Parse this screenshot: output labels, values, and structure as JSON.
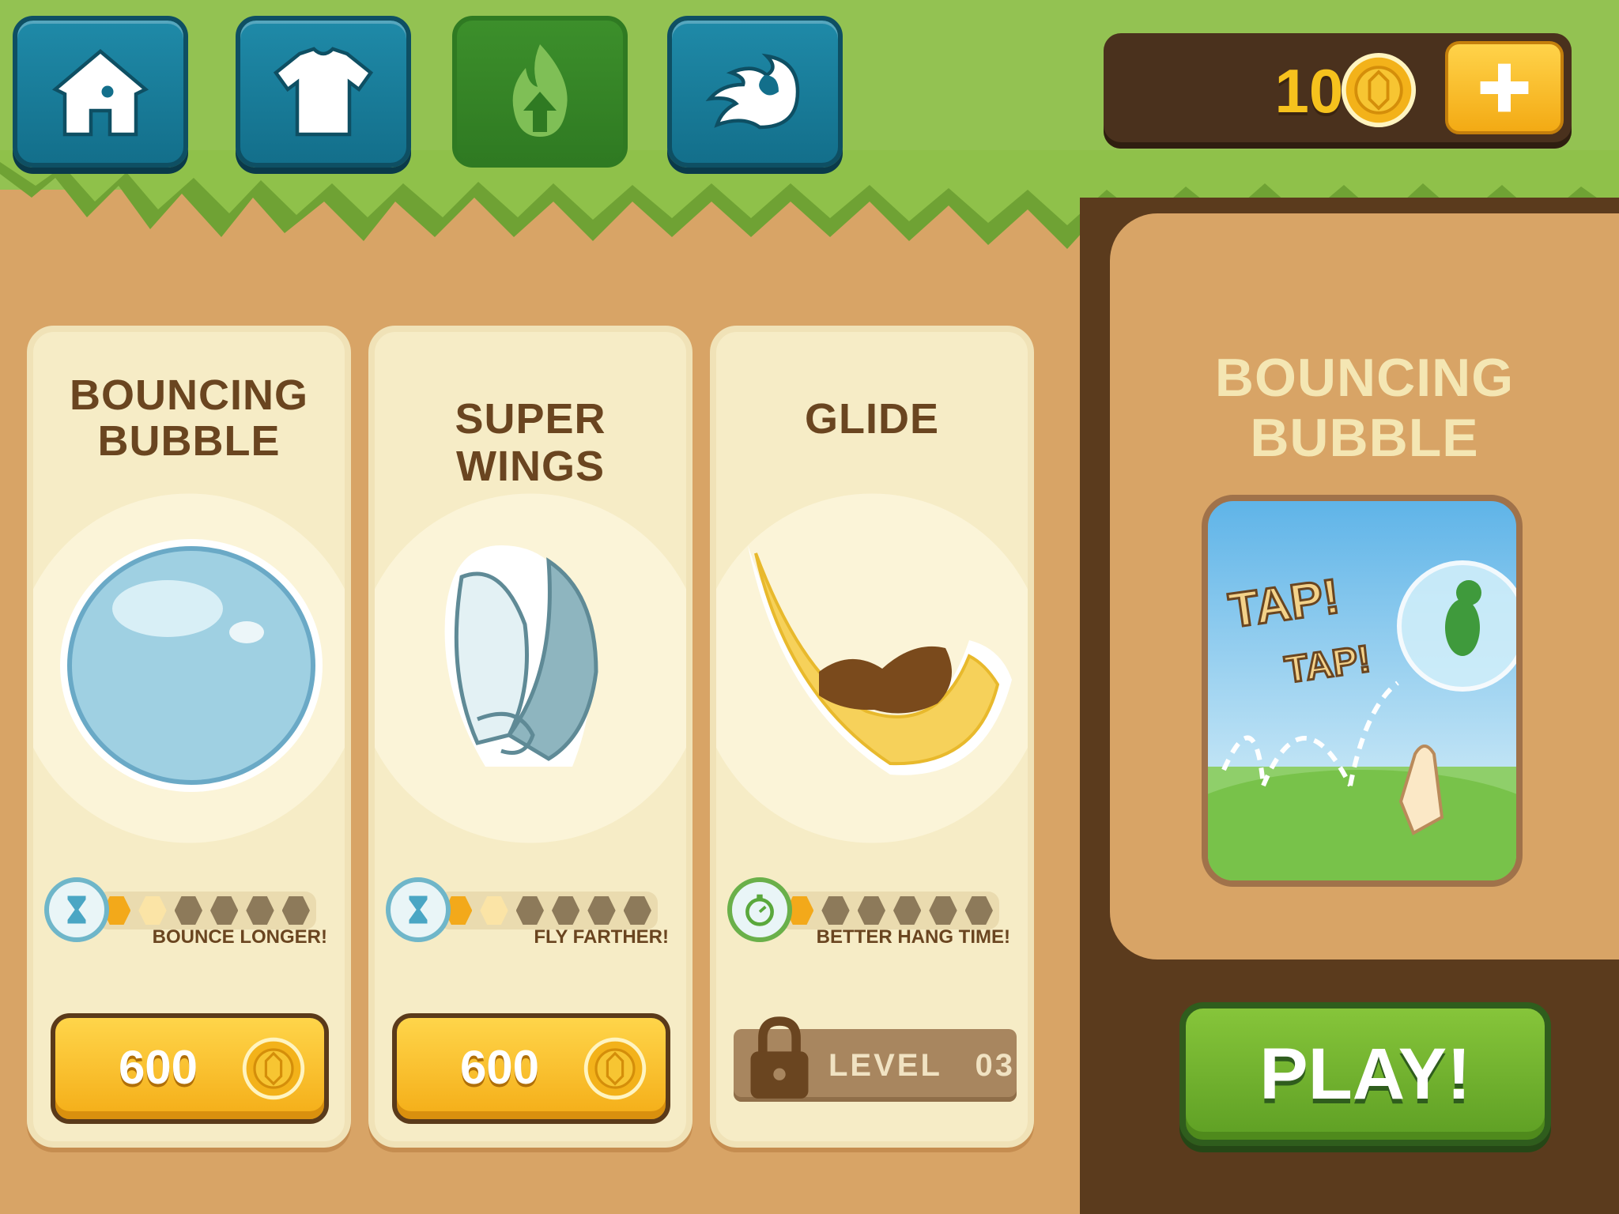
{
  "nav": {
    "items": [
      {
        "icon": "home-icon"
      },
      {
        "icon": "shirt-icon"
      },
      {
        "icon": "flame-upgrade-icon",
        "active": true
      },
      {
        "icon": "dash-icon"
      }
    ]
  },
  "wallet": {
    "coins": "1000",
    "coin_icon": "coin-icon",
    "add_icon": "plus-icon"
  },
  "cards": [
    {
      "title_line1": "BOUNCING",
      "title_line2": "BUBBLE",
      "icon": "bubble-icon",
      "badge_icon": "hourglass-icon",
      "level_filled": 1,
      "level_half": 1,
      "level_total": 6,
      "caption": "BOUNCE LONGER!",
      "price": "600"
    },
    {
      "title_line1": "SUPER WINGS",
      "icon": "wings-icon",
      "badge_icon": "hourglass-icon",
      "level_filled": 1,
      "level_half": 1,
      "level_total": 6,
      "caption": "FLY FARTHER!",
      "price": "600"
    },
    {
      "title_line1": "GLIDE",
      "icon": "glide-icon",
      "badge_icon": "stopwatch-icon",
      "level_filled": 1,
      "level_half": 0,
      "level_total": 6,
      "caption": "BETTER HANG TIME!",
      "locked_text": "LEVEL   03"
    }
  ],
  "detail": {
    "title": "BOUNCING BUBBLE",
    "tap1": "TAP!",
    "tap2": "TAP!",
    "play_label": "PLAY!"
  },
  "colors": {
    "grass": "#8fbf4a",
    "teal_button": "#1f8aa8",
    "gold": "#f6c21d",
    "play_green": "#6fb22e",
    "panel_bg": "#d8a466",
    "dark_wood": "#5b3b1d"
  }
}
